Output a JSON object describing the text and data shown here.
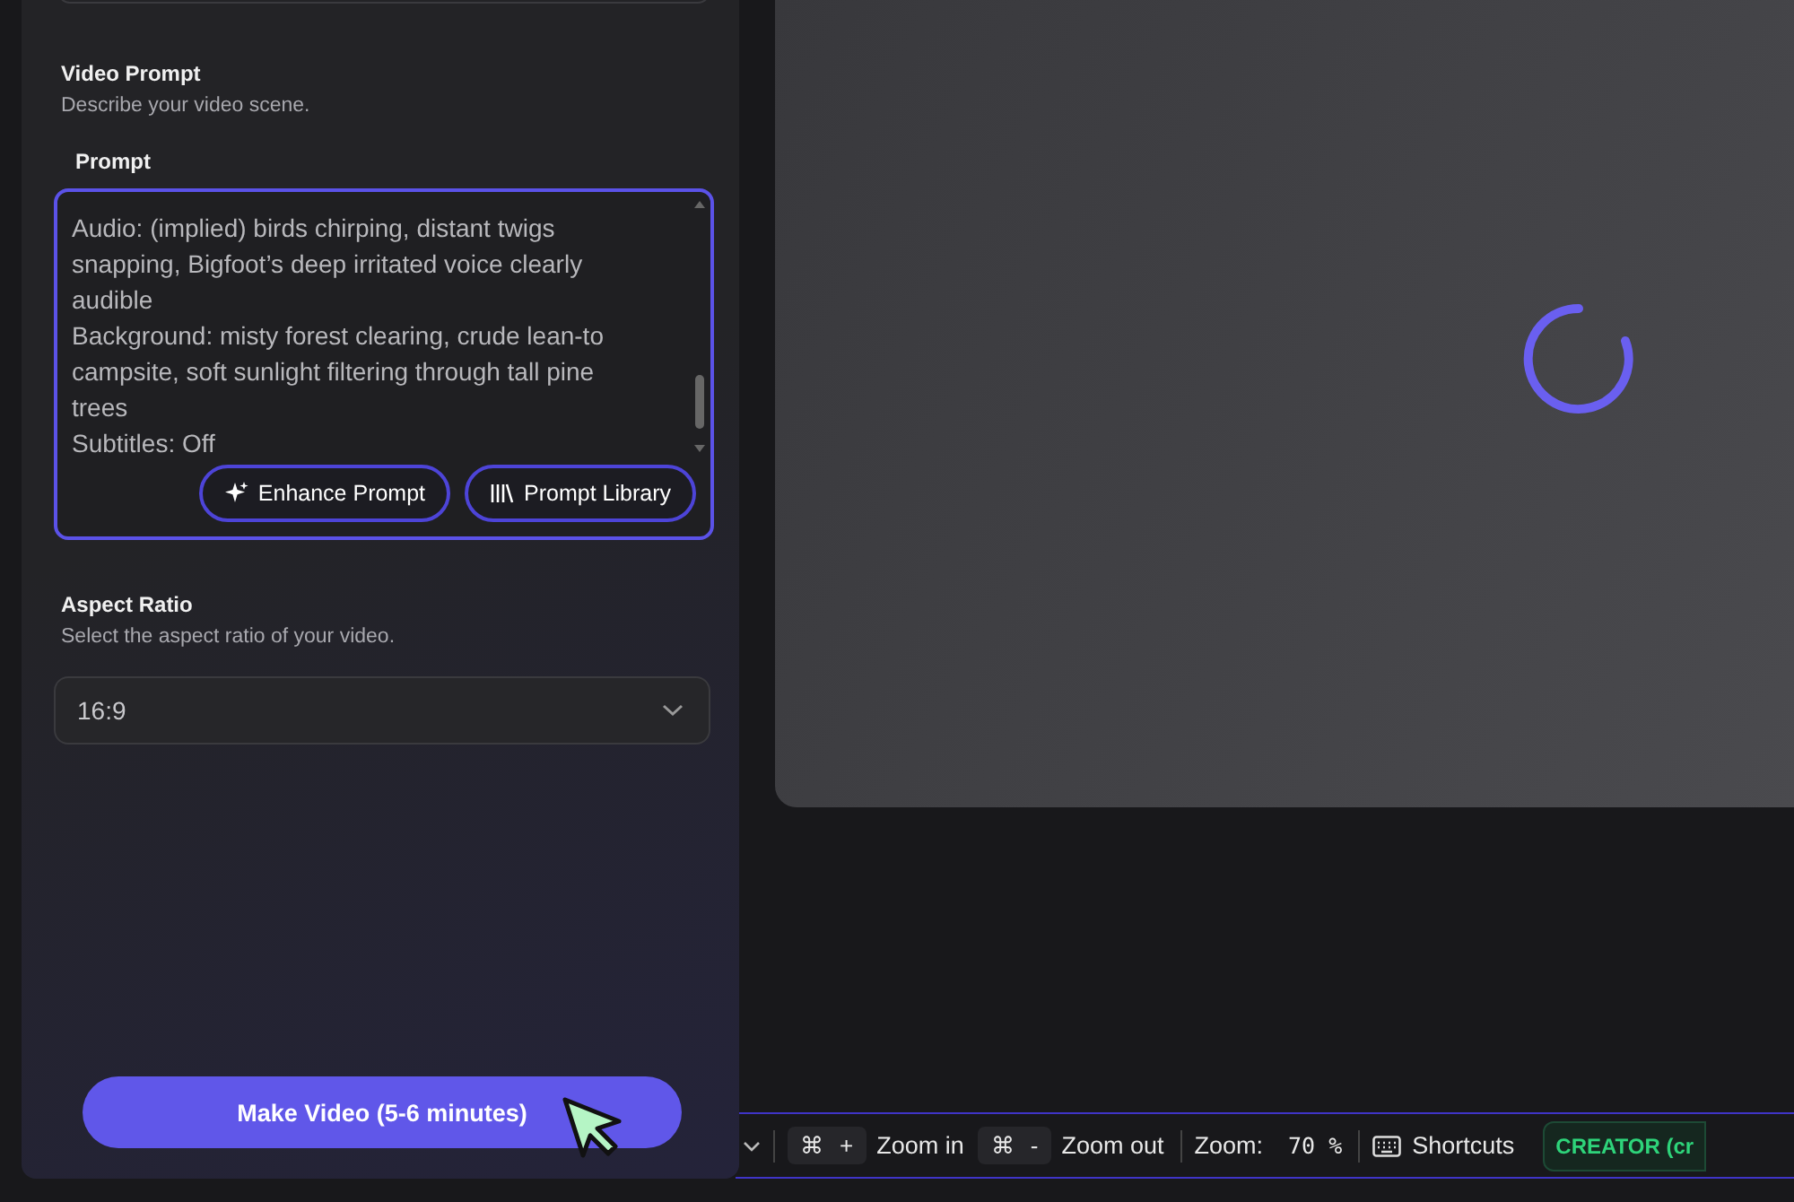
{
  "video_prompt": {
    "title": "Video Prompt",
    "description": "Describe your video scene."
  },
  "prompt": {
    "label": "Prompt",
    "lines": [
      "Audio: (implied) birds chirping, distant twigs snapping, Bigfoot’s deep irritated voice clearly audible",
      "Background: misty forest clearing, crude lean-to campsite, soft sunlight filtering through tall pine trees",
      "Subtitles: Off"
    ],
    "buttons": [
      {
        "kind": "sparkle",
        "label": "Enhance Prompt"
      },
      {
        "kind": "library",
        "label": "Prompt Library"
      }
    ]
  },
  "aspect_ratio": {
    "title": "Aspect Ratio",
    "description": "Select the aspect ratio of your video.",
    "value": "16:9"
  },
  "make_button": "Make Video (5-6 minutes)",
  "status_bar": {
    "zoom_in": {
      "keys": [
        "⌘",
        "+"
      ],
      "label": "Zoom in"
    },
    "zoom_out": {
      "keys": [
        "⌘",
        "-"
      ],
      "label": "Zoom out"
    },
    "zoom_label": "Zoom:",
    "zoom_value": "70 %",
    "shortcuts": "Shortcuts",
    "plan": "CREATOR (cr"
  }
}
